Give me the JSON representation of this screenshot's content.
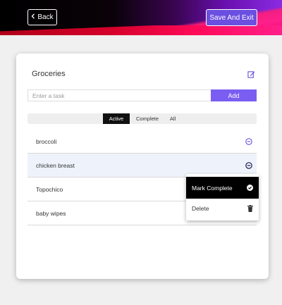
{
  "header": {
    "back_label": "Back",
    "back_icon": "chevron-left-icon",
    "save_label": "Save And Exit"
  },
  "list_title": "Groceries",
  "task_input": {
    "placeholder": "Enter a task",
    "value": "",
    "add_label": "Add"
  },
  "filters": [
    {
      "label": "Active",
      "selected": true
    },
    {
      "label": "Complete",
      "selected": false
    },
    {
      "label": "All",
      "selected": false
    }
  ],
  "tasks": [
    {
      "label": "broccoli"
    },
    {
      "label": "chicken breast",
      "selected": true
    },
    {
      "label": "Topochico"
    },
    {
      "label": "baby wipes"
    }
  ],
  "context_menu": {
    "mark_complete_label": "Mark Complete",
    "delete_label": "Delete"
  },
  "colors": {
    "accent": "#7a5ef2",
    "selected_row": "#eef3fb"
  }
}
